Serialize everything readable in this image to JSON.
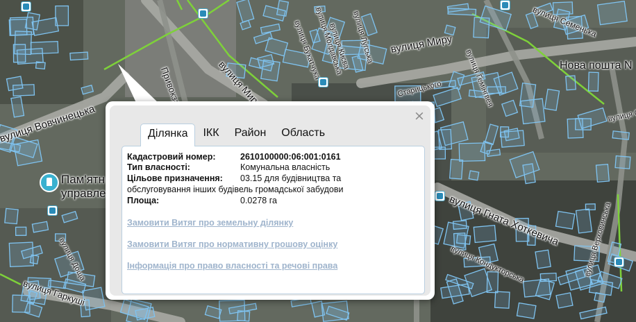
{
  "map": {
    "streets": [
      {
        "name": "вулиця Мазепи",
        "text": "вулиця Вовчинецька"
      },
      {
        "text": "вулиця Миру"
      },
      {
        "text": "вулиця Мирy"
      },
      {
        "text": "Привокзальна"
      },
      {
        "text": "вулиця Молдавська"
      },
      {
        "text": "вулиця Бука"
      },
      {
        "text": "вулиця Лугська"
      },
      {
        "text": "вулиця Букатчука"
      },
      {
        "text": "вулиця Кисва"
      },
      {
        "text": "вулиця Семенька"
      },
      {
        "text": "вулиця Гемінгвея"
      },
      {
        "text": "вулиця Гната Хоткевича"
      },
      {
        "text": "Старицького"
      },
      {
        "text": "вулиця Кондукторська"
      },
      {
        "text": "вулиця Довженка"
      },
      {
        "text": "вулиця Доща"
      },
      {
        "text": "вулиця Гаркуші"
      },
      {
        "text": "вулиця Верховинська"
      },
      {
        "text": "вулиця Сєв"
      }
    ],
    "poi": {
      "title": "Пам'ятн",
      "subtitle": "управле"
    },
    "post": "Нова пошта N",
    "accent_color": "#3ab1cf",
    "parcel_color": "#7fc3f0"
  },
  "popup": {
    "close_symbol": "×",
    "tabs": [
      "Ділянка",
      "ІКК",
      "Район",
      "Область"
    ],
    "active_tab": "Ділянка",
    "fields": {
      "cadastral_label": "Кадастровий номер:",
      "cadastral_value": "2610100000:06:001:0161",
      "ownership_label": "Тип власності:",
      "ownership_value": "Комунальна власність",
      "purpose_label": "Цільове призначення:",
      "purpose_value_line1": "03.15 для будівництва та",
      "purpose_value_line2": "обслуговування інших будівель громадської забудови",
      "area_label": "Площа:",
      "area_value": "0.0278 га"
    },
    "links": [
      "Замовити Витяг про земельну ділянку",
      "Замовити Витяг про нормативну грошову оцінку",
      "Інформація про право власності та речові права"
    ],
    "link_color": "#9fb4cc"
  }
}
